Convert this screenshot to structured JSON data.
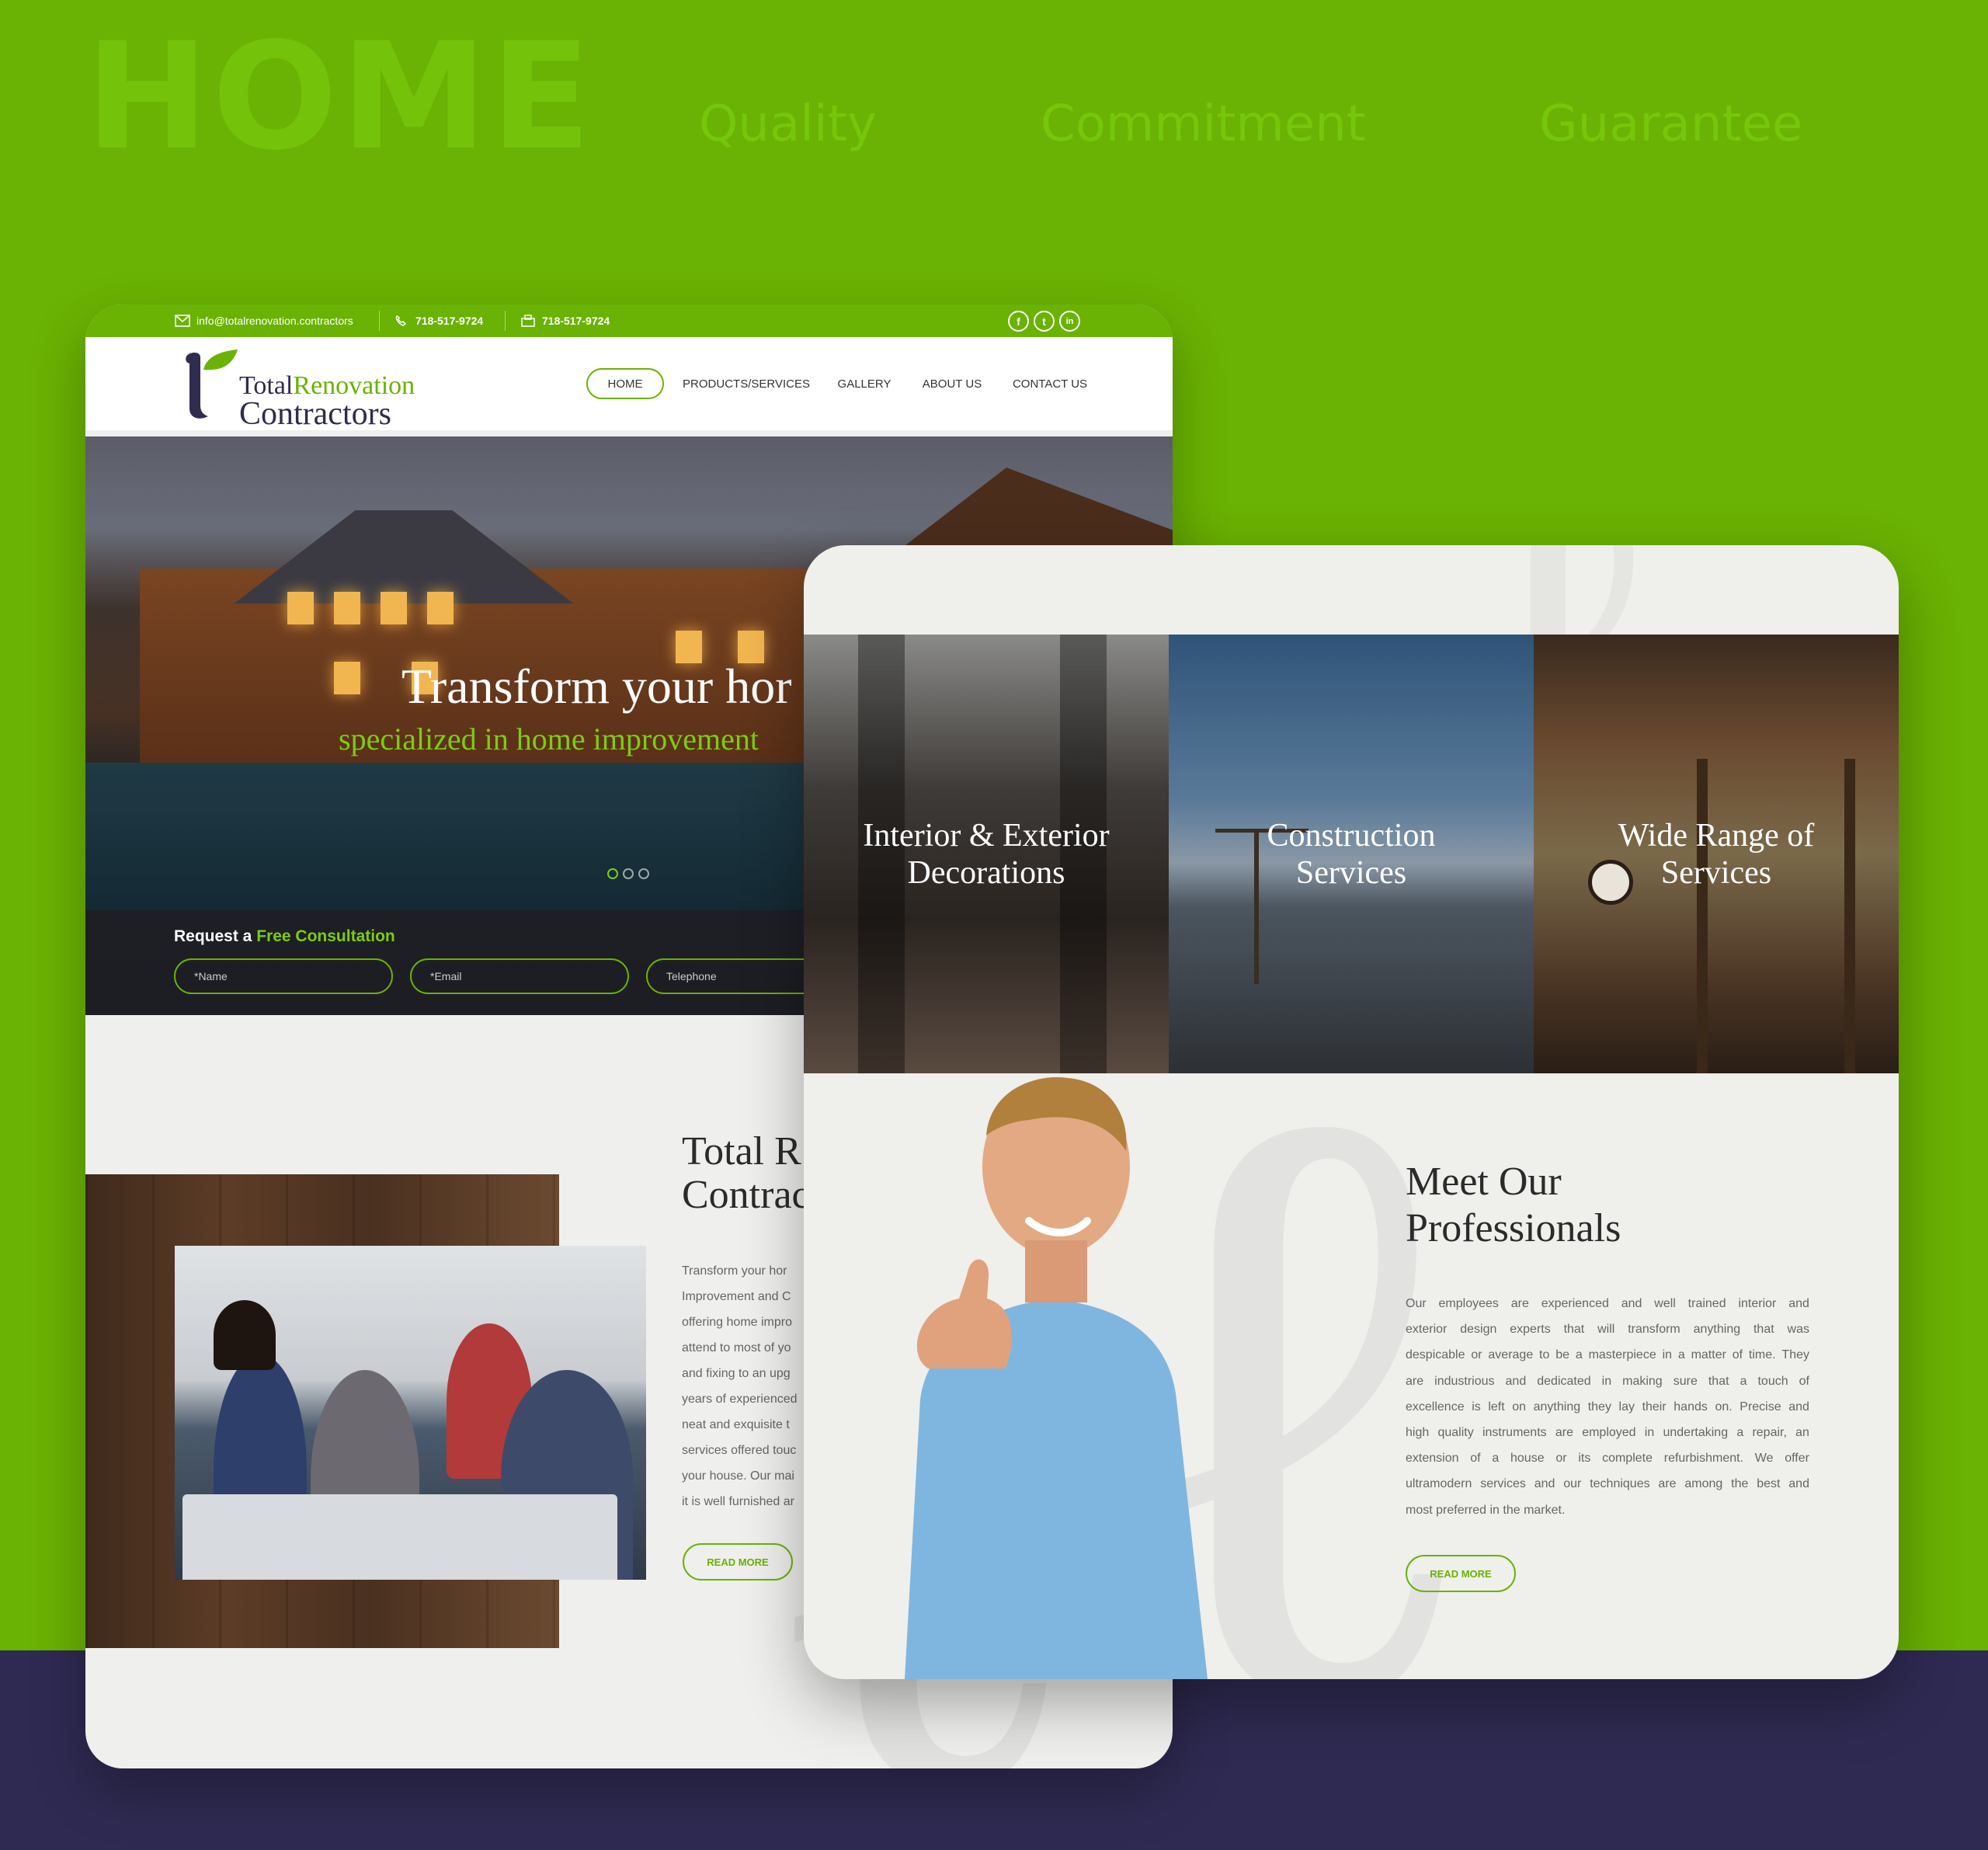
{
  "backdrop": {
    "heading": "HOME",
    "taglines": [
      "Quality",
      "Commitment",
      "Guarantee"
    ],
    "colors": {
      "green": "#6ab203",
      "navy": "#2f2a52"
    }
  },
  "home_page": {
    "topbar": {
      "email": "info@totalrenovation.contractors",
      "phone": "718-517-9724",
      "fax": "718-517-9724",
      "social": [
        {
          "icon": "facebook-icon",
          "glyph": "f"
        },
        {
          "icon": "twitter-icon",
          "glyph": "t"
        },
        {
          "icon": "linkedin-icon",
          "glyph": "in"
        }
      ]
    },
    "logo": {
      "word1": "Total",
      "word2": "Renovation",
      "word3": "Contractors"
    },
    "nav": [
      "HOME",
      "PRODUCTS/SERVICES",
      "GALLERY",
      "ABOUT US",
      "CONTACT US"
    ],
    "nav_active": "HOME",
    "hero": {
      "title": "Transform your hor",
      "subtitle": "specialized in home improvement",
      "slides": 3,
      "active_slide": 1
    },
    "consultation": {
      "prefix": "Request a",
      "highlight": "Free Consultation",
      "fields": [
        {
          "placeholder": "*Name"
        },
        {
          "placeholder": "*Email"
        },
        {
          "placeholder": "Telephone"
        }
      ]
    },
    "about": {
      "title_line1": "Total R",
      "title_line2": "Contrac",
      "lines": [
        "Transform your hor",
        "Improvement and C",
        "offering home impro",
        "attend to most of yo",
        "and fixing to an upg",
        "years of experienced",
        "neat and exquisite t",
        "services offered touc",
        "your house. Our mai",
        "it is well furnished ar"
      ],
      "button": "READ MORE"
    }
  },
  "services_page": {
    "services": [
      {
        "line1": "Interior & Exterior",
        "line2": "Decorations"
      },
      {
        "line1": "Construction",
        "line2": "Services"
      },
      {
        "line1": "Wide Range of",
        "line2": "Services"
      }
    ],
    "professionals": {
      "title_line1": "Meet Our",
      "title_line2": "Professionals",
      "lines": [
        "Our employees are experienced and well trained interior and",
        "exterior design experts that will transform anything that was",
        "despicable or average to be a masterpiece in a matter of time. They",
        "are industrious and dedicated in making sure that a touch of",
        "excellence is left on anything they lay their hands on. Precise and",
        "high quality instruments are employed in undertaking a repair, an",
        "extension of a house or its complete refurbishment. We offer",
        "ultramodern services and our techniques are among the best and",
        "most preferred in the market."
      ],
      "button": "READ MORE"
    }
  }
}
